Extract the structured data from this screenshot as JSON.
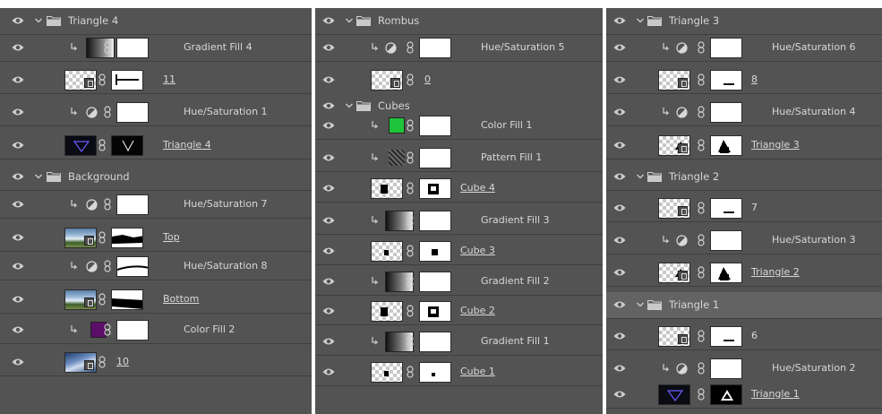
{
  "columns": [
    {
      "rows": [
        {
          "kind": "group",
          "title": "Triangle 4"
        },
        {
          "kind": "fill",
          "fill": "gradient",
          "name": "Gradient Fill 4"
        },
        {
          "kind": "layer",
          "thumb": "smart",
          "mask": "line",
          "name": "11",
          "underline": true
        },
        {
          "kind": "fill",
          "fill": "adjustment",
          "name": "Hue/Saturation 1"
        },
        {
          "kind": "layer",
          "thumb": "dark-triangle",
          "mask": "dark-v",
          "name": "Triangle 4",
          "underline": true
        },
        {
          "kind": "group",
          "title": "Background"
        },
        {
          "kind": "fill",
          "fill": "adjustment",
          "name": "Hue/Saturation 7"
        },
        {
          "kind": "layer",
          "thumb": "photo",
          "mask": "band",
          "name": "Top",
          "underline": true
        },
        {
          "kind": "fill",
          "fill": "adjustment",
          "name": "Hue/Saturation 8",
          "mask": "thin-line"
        },
        {
          "kind": "layer",
          "thumb": "photo",
          "mask": "band-low",
          "name": "Bottom",
          "underline": true
        },
        {
          "kind": "fill",
          "fill": "color",
          "color": "#5b0f68",
          "name": "Color Fill 2"
        },
        {
          "kind": "layer",
          "thumb": "photo2",
          "mask": "none",
          "name": "10",
          "underline": true
        }
      ]
    },
    {
      "rows": [
        {
          "kind": "group",
          "title": "Rombus"
        },
        {
          "kind": "fill",
          "fill": "adjustment",
          "name": "Hue/Saturation 5"
        },
        {
          "kind": "layer",
          "thumb": "smart",
          "mask": "none",
          "name": "0",
          "underline": true
        },
        {
          "kind": "group",
          "title": "Cubes"
        },
        {
          "kind": "fill",
          "fill": "color",
          "color": "#1fc43a",
          "name": "Color Fill 1"
        },
        {
          "kind": "fill",
          "fill": "pattern",
          "name": "Pattern Fill 1"
        },
        {
          "kind": "layer",
          "thumb": "cube",
          "mask": "cube",
          "name": "Cube 4",
          "underline": true
        },
        {
          "kind": "fill",
          "fill": "gradient",
          "name": "Gradient Fill 3"
        },
        {
          "kind": "layer",
          "thumb": "cube-small",
          "mask": "cube-small",
          "name": "Cube 3",
          "underline": true
        },
        {
          "kind": "fill",
          "fill": "gradient",
          "name": "Gradient Fill 2"
        },
        {
          "kind": "layer",
          "thumb": "cube",
          "mask": "cube",
          "name": "Cube 2",
          "underline": true
        },
        {
          "kind": "fill",
          "fill": "gradient",
          "name": "Gradient Fill 1"
        },
        {
          "kind": "layer",
          "thumb": "cube-small",
          "mask": "dot",
          "name": "Cube 1",
          "underline": true
        }
      ]
    },
    {
      "rows": [
        {
          "kind": "group",
          "title": "Triangle 3"
        },
        {
          "kind": "fill",
          "fill": "adjustment",
          "name": "Hue/Saturation 6"
        },
        {
          "kind": "layer",
          "thumb": "smart",
          "mask": "dash",
          "name": "8",
          "underline": true
        },
        {
          "kind": "fill",
          "fill": "adjustment",
          "name": "Hue/Saturation 4"
        },
        {
          "kind": "layer",
          "thumb": "tri-shape",
          "mask": "tri-shape",
          "name": "Triangle 3",
          "underline": true
        },
        {
          "kind": "group",
          "title": "Triangle 2"
        },
        {
          "kind": "layer",
          "thumb": "smart",
          "mask": "dash",
          "name": "7",
          "underline": false
        },
        {
          "kind": "fill",
          "fill": "adjustment",
          "name": "Hue/Saturation 3"
        },
        {
          "kind": "layer",
          "thumb": "tri-shape",
          "mask": "tri-shape",
          "name": "Triangle 2",
          "underline": true
        },
        {
          "kind": "group",
          "title": "Triangle 1",
          "highlight": true
        },
        {
          "kind": "layer",
          "thumb": "smart",
          "mask": "dash",
          "name": "6",
          "underline": false
        },
        {
          "kind": "fill",
          "fill": "adjustment",
          "name": "Hue/Saturation 2"
        },
        {
          "kind": "layer",
          "thumb": "dark-triangle",
          "mask": "tri-black",
          "name": "Triangle 1",
          "underline": true
        }
      ]
    }
  ]
}
